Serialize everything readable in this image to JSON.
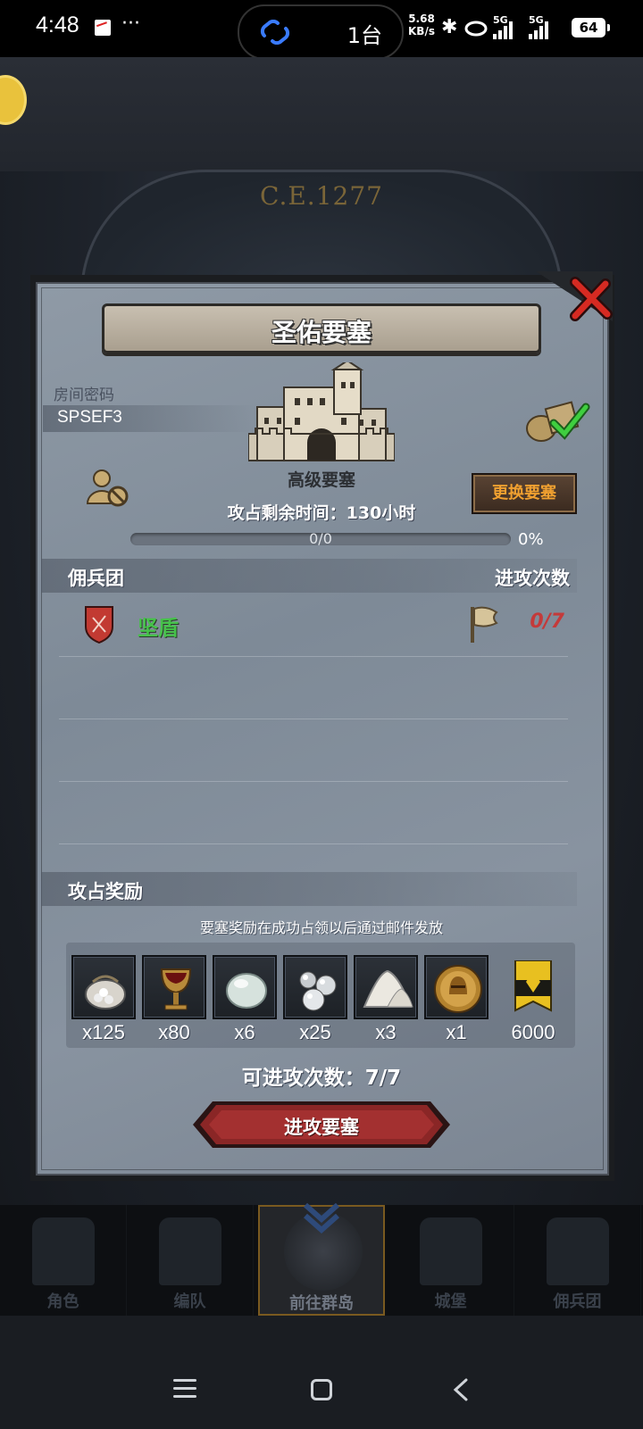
{
  "status_bar": {
    "time": "4:48",
    "dots": "···",
    "pill_text": "1台",
    "speed_value": "5.68",
    "speed_unit": "KB/s",
    "net1": "5G",
    "net2": "5G",
    "battery": "64"
  },
  "background": {
    "era": "C.E.1277"
  },
  "dialog": {
    "title": "圣佑要塞",
    "room_label": "房间密码",
    "room_code": "SPSEF3",
    "fortress_level": "高级要塞",
    "change_button": "更换要塞",
    "time_left": "攻占剩余时间：130小时",
    "progress_text": "0/0",
    "progress_fraction": 0,
    "progress_pct": "0%",
    "mercenary_header": "佣兵团",
    "attack_count_header": "进攻次数",
    "mercenaries": [
      {
        "name": "坚盾",
        "count": "0/7"
      }
    ],
    "rewards_header": "攻占奖励",
    "rewards_note": "要塞奖励在成功占领以后通过邮件发放",
    "rewards": [
      {
        "icon": "silver-sack-icon",
        "qty": "x125"
      },
      {
        "icon": "goblet-icon",
        "qty": "x80"
      },
      {
        "icon": "pearl-icon",
        "qty": "x6"
      },
      {
        "icon": "silver-pearls-icon",
        "qty": "x25"
      },
      {
        "icon": "salt-pile-icon",
        "qty": "x3"
      },
      {
        "icon": "knight-medal-icon",
        "qty": "x1"
      },
      {
        "icon": "guild-banner-icon",
        "qty": "6000"
      }
    ],
    "attacks_available": "可进攻次数：7/7",
    "attack_button": "进攻要塞"
  },
  "game_nav": [
    {
      "label": "角色",
      "icon": "knight-helmet-icon"
    },
    {
      "label": "编队",
      "icon": "armored-knight-icon"
    },
    {
      "label": "前往群岛",
      "icon": "island-compass-icon",
      "active": true
    },
    {
      "label": "城堡",
      "icon": "castle-icon"
    },
    {
      "label": "佣兵团",
      "icon": "tower-icon"
    }
  ],
  "colors": {
    "merc_name": "#46c24a",
    "merc_count": "#c43a3a",
    "change_button_text": "#f0a030",
    "attack_button": "#8a2626"
  }
}
